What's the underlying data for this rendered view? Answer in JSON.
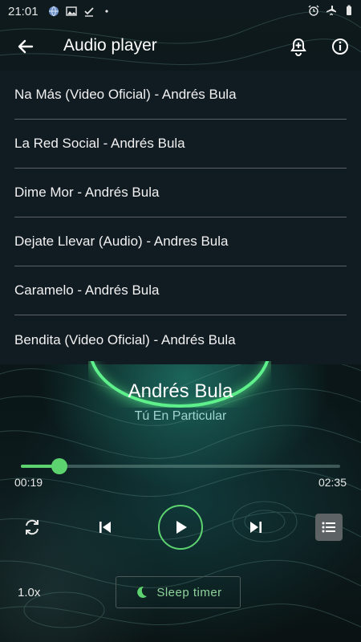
{
  "status_bar": {
    "time": "21:01",
    "left_icons": [
      "globe-icon",
      "image-icon",
      "check-icon",
      "dot-icon"
    ],
    "right_icons": [
      "alarm-icon",
      "airplane-icon",
      "battery-icon"
    ]
  },
  "app_bar": {
    "title": "Audio player",
    "actions": [
      "back-arrow-icon",
      "alarm-add-icon",
      "info-icon"
    ]
  },
  "playlist": {
    "items": [
      "Na Más (Video Oficial) - Andrés Bula",
      "La Red Social - Andrés Bula",
      "Dime Mor - Andrés Bula",
      "Dejate Llevar (Audio) - Andres Bula",
      "Caramelo - Andrés Bula",
      "Bendita (Video Oficial) - Andrés Bula"
    ]
  },
  "now_playing": {
    "artist": "Andrés Bula",
    "track": "Tú En Particular",
    "elapsed": "00:19",
    "duration": "02:35",
    "progress_fraction": 0.12
  },
  "controls": {
    "speed": "1.0x",
    "sleep_timer_label": "Sleep timer"
  },
  "colors": {
    "accent": "#5dd36f",
    "panel": "#111b22"
  }
}
